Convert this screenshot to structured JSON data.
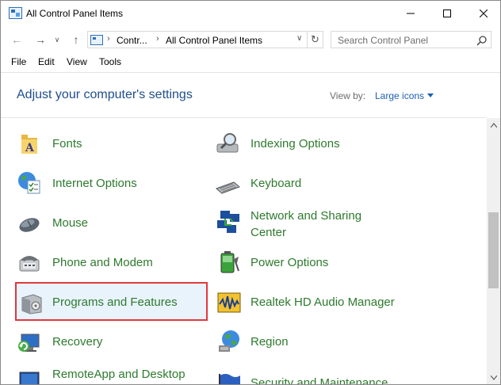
{
  "window": {
    "title": "All Control Panel Items",
    "controls": {
      "minimize": "minimize-icon",
      "maximize": "maximize-icon",
      "close": "close-icon"
    }
  },
  "address": {
    "crumbs": [
      "Contr...",
      "All Control Panel Items"
    ],
    "search_placeholder": "Search Control Panel"
  },
  "menu": [
    "File",
    "Edit",
    "View",
    "Tools"
  ],
  "header": {
    "title": "Adjust your computer's settings",
    "view_by_label": "View by:",
    "view_by_value": "Large icons"
  },
  "items": [
    {
      "label": "Fonts",
      "icon": "fonts-folder-icon"
    },
    {
      "label": "Indexing Options",
      "icon": "indexing-magnifier-icon"
    },
    {
      "label": "Internet Options",
      "icon": "internet-globe-icon"
    },
    {
      "label": "Keyboard",
      "icon": "keyboard-icon"
    },
    {
      "label": "Mouse",
      "icon": "mouse-icon"
    },
    {
      "label": "Network and Sharing",
      "label2": "Center",
      "icon": "network-icon"
    },
    {
      "label": "Phone and Modem",
      "icon": "phone-modem-icon"
    },
    {
      "label": "Power Options",
      "icon": "battery-icon"
    },
    {
      "label": "Programs and Features",
      "icon": "programs-box-icon",
      "selected": true
    },
    {
      "label": "Realtek HD Audio Manager",
      "icon": "audio-manager-icon"
    },
    {
      "label": "Recovery",
      "icon": "recovery-icon"
    },
    {
      "label": "Region",
      "icon": "region-globe-icon"
    },
    {
      "label": "RemoteApp and Desktop",
      "icon": "remote-desktop-icon"
    },
    {
      "label": "Security and Maintenance",
      "icon": "security-flag-icon"
    }
  ],
  "colors": {
    "link_green": "#2d7a2d",
    "heading_blue": "#1e4e8c",
    "selection_border": "#e2373f",
    "selection_fill": "#e8f3fc"
  }
}
